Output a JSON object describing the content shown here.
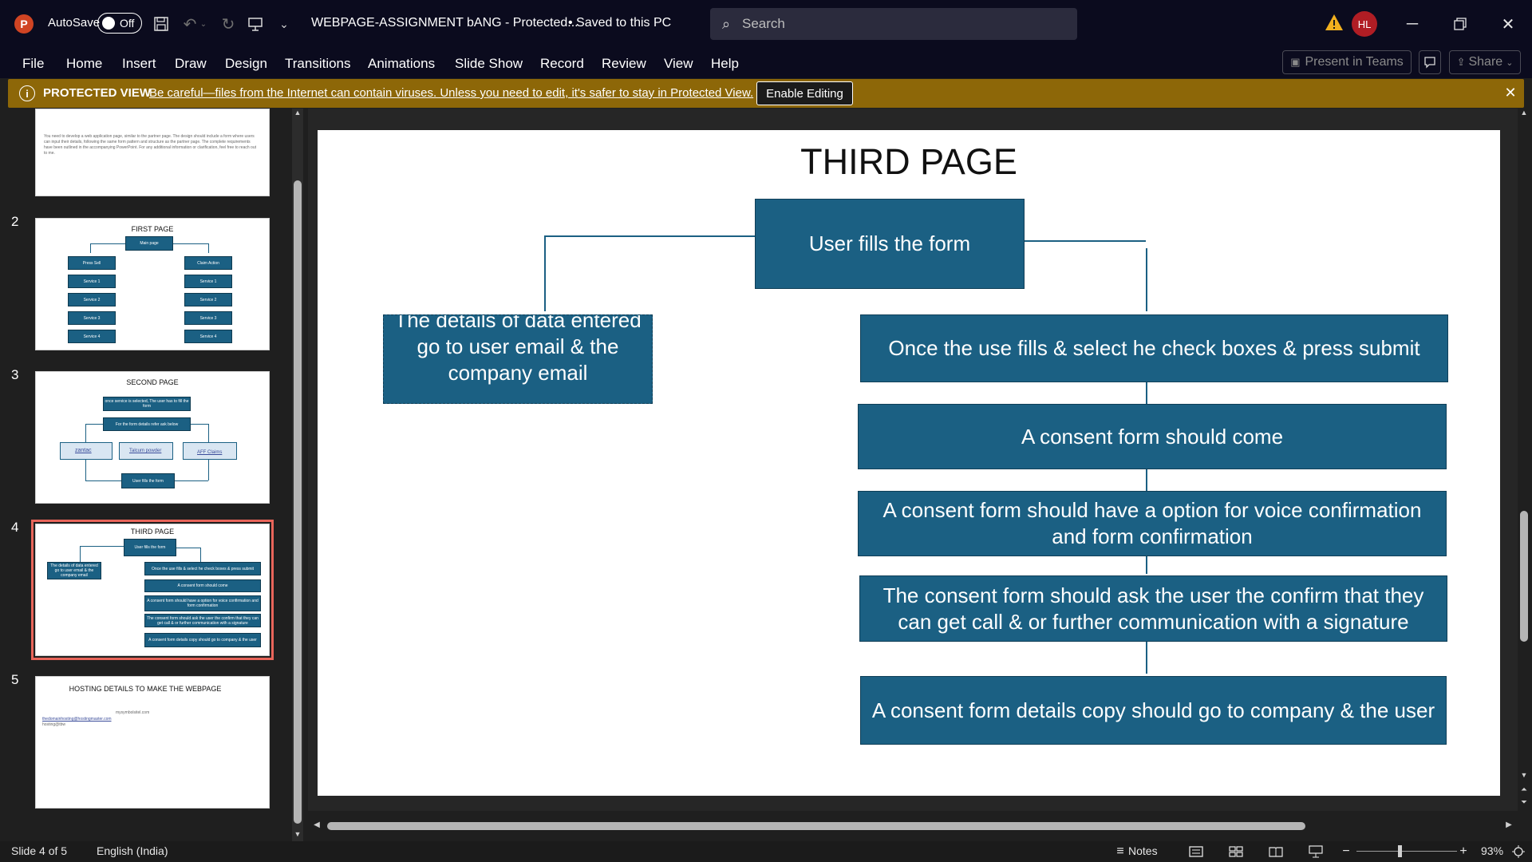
{
  "window": {
    "app_logo": "P",
    "autosave_label": "AutoSave",
    "autosave_state": "Off",
    "doc_title": "WEBPAGE-ASSIGNMENT bANG  -  Protected...",
    "saved_status": "• Saved to this PC",
    "search_placeholder": "Search",
    "avatar_initials": "HL",
    "icons": [
      "save-icon",
      "undo-icon",
      "redo-icon",
      "present-from-start-icon",
      "customize-toolbar-icon",
      "warning-icon",
      "minimize-icon",
      "restore-icon",
      "close-icon"
    ]
  },
  "ribbon": {
    "tabs": [
      "File",
      "Home",
      "Insert",
      "Draw",
      "Design",
      "Transitions",
      "Animations",
      "Slide Show",
      "Record",
      "Review",
      "View",
      "Help"
    ],
    "present_in_teams": "Present in Teams",
    "share": "Share"
  },
  "protected_view": {
    "title": "PROTECTED VIEW",
    "message": "Be careful—files from the Internet can contain viruses. Unless you need to edit, it's safer to stay in Protected View.",
    "button": "Enable Editing",
    "bar_color": "#8d6708"
  },
  "thumbnails": [
    {
      "number": "",
      "text": "You need to develop a web application page, similar to the partner page. The design should include a form where users can input their details, following the same form pattern and structure as the partner page. The complete requirements have been outlined in the accompanying PowerPoint. For any additional information or clarification, feel free to reach out to me."
    },
    {
      "number": "2",
      "title": "FIRST PAGE",
      "root": "Main page",
      "left": [
        "Press Sell",
        "Service 1",
        "Service 2",
        "Service 3",
        "Service 4"
      ],
      "right": [
        "Claim Action",
        "Service 1",
        "Service 2",
        "Service 3",
        "Service 4"
      ]
    },
    {
      "number": "3",
      "title": "SECOND PAGE",
      "top": "once service is selected, The user has to fill the form",
      "middle": "For the form details refer ask below",
      "links": [
        "zantac",
        "Talcum powder",
        "AFF Claims"
      ],
      "bottom": "User fills the form"
    },
    {
      "number": "4",
      "title": "THIRD PAGE",
      "root": "User fills the form",
      "left": "The details of data entered go to user email & the company email",
      "right": [
        "Once the use fills & select he check boxes & press submit",
        "A consent form should come",
        "A consent form should have a option for voice confirmation and form confirmation",
        "The consent form should ask the user the confirm that they can get call & or further communication with a signature",
        "A consent form details copy should go to company & the user"
      ]
    },
    {
      "number": "5",
      "title": "HOSTING DETAILS TO MAKE THE WEBPAGE",
      "line1": "mysymbolsitel.com",
      "line2": "thedomainhosting@hostingmaster.com",
      "line3": "hosting@tbw"
    }
  ],
  "slide": {
    "title": "THIRD PAGE",
    "root_box": "User fills the form",
    "left_box": "The details of data entered go to user email   & the company email",
    "right_boxes": [
      "Once the use fills  & select he check boxes & press submit",
      "A consent form should come",
      "A consent form  should have a option for voice confirmation and form confirmation",
      "The consent form should ask the user the confirm that they can get call  & or further communication   with a signature",
      "A consent form details copy should go to company & the user"
    ],
    "box_color": "#1b6083"
  },
  "status": {
    "slide_info": "Slide 4 of 5",
    "language": "English (India)",
    "notes": "Notes",
    "zoom": "93%",
    "zoom_fraction": 0.93
  }
}
